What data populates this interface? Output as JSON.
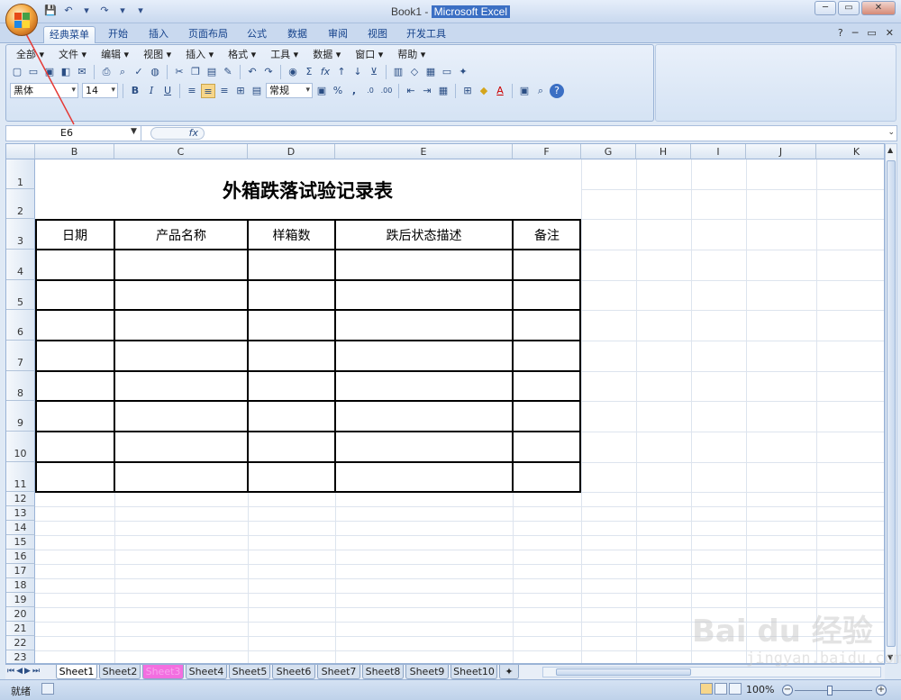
{
  "window": {
    "title_doc": "Book1 - ",
    "title_app": "Microsoft Excel",
    "controls": [
      "─",
      "▭",
      "✕"
    ]
  },
  "qat": [
    "💾",
    "↶",
    "▾",
    "↷",
    "▾",
    "▾"
  ],
  "tabs": [
    {
      "label": "经典菜单",
      "active": true
    },
    {
      "label": "开始"
    },
    {
      "label": "插入"
    },
    {
      "label": "页面布局"
    },
    {
      "label": "公式"
    },
    {
      "label": "数据"
    },
    {
      "label": "审阅"
    },
    {
      "label": "视图"
    },
    {
      "label": "开发工具"
    }
  ],
  "tab_right": [
    "?",
    "─",
    "▭",
    "✕"
  ],
  "menus": [
    "全部 ▾",
    "文件 ▾",
    "编辑 ▾",
    "视图 ▾",
    "插入 ▾",
    "格式 ▾",
    "工具 ▾",
    "数据 ▾",
    "窗口 ▾",
    "帮助 ▾"
  ],
  "toolbar": {
    "font_name": "黑体",
    "font_size": "14",
    "bold": "B",
    "italic": "I",
    "underline": "U",
    "number_format": "常规",
    "percent": "%",
    "comma": ",",
    "sum": "Σ",
    "fx": "fx"
  },
  "formula_bar": {
    "name_box": "E6",
    "fx_label": "fx",
    "value": ""
  },
  "grid": {
    "columns": [
      "B",
      "C",
      "D",
      "E",
      "F",
      "G",
      "H",
      "I",
      "J",
      "K"
    ],
    "rows": [
      "1",
      "2",
      "3",
      "4",
      "5",
      "6",
      "7",
      "8",
      "9",
      "10",
      "11",
      "12",
      "13",
      "14",
      "15",
      "16",
      "17",
      "18",
      "19",
      "20",
      "21",
      "22",
      "23"
    ]
  },
  "document": {
    "title": "外箱跌落试验记录表",
    "headers": [
      "日期",
      "产品名称",
      "样箱数",
      "跌后状态描述",
      "备注"
    ]
  },
  "sheets": [
    {
      "label": "Sheet1",
      "active": true
    },
    {
      "label": "Sheet2"
    },
    {
      "label": "Sheet3",
      "highlight": "#f36ee0"
    },
    {
      "label": "Sheet4"
    },
    {
      "label": "Sheet5"
    },
    {
      "label": "Sheet6"
    },
    {
      "label": "Sheet7"
    },
    {
      "label": "Sheet8"
    },
    {
      "label": "Sheet9"
    },
    {
      "label": "Sheet10"
    }
  ],
  "status": {
    "ready": "就绪",
    "zoom": "100%",
    "zoom_level": 1.0
  },
  "watermark": {
    "text": "Bai du 经验",
    "url": "jingyan.baidu.com"
  },
  "colors": {
    "accent": "#15428b",
    "ribbon": "#dfe9f5",
    "annotation_arrow": "#e53935"
  }
}
